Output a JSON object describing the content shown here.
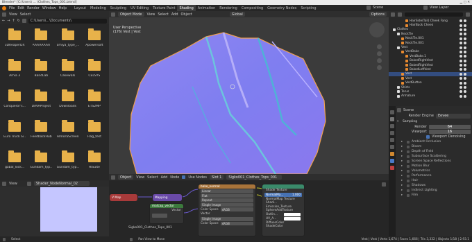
{
  "title_bar": {
    "text": "Blender* [C:\\Users\\ ... \\Clothes_Tops_001.blend]"
  },
  "menu": {
    "items": [
      "File",
      "Edit",
      "Render",
      "Window",
      "Help"
    ]
  },
  "workspaces": [
    "Layout",
    "Modeling",
    "Sculpting",
    "UV Editing",
    "Texture Paint",
    "Shading",
    "Animation",
    "Rendering",
    "Compositing",
    "Geometry Nodes",
    "Scripting"
  ],
  "active_workspace": "Shading",
  "scene": {
    "label": "Scene",
    "view_layer": "View Layer"
  },
  "file_browser": {
    "view_label": "View",
    "select_label": "Select",
    "path": "C:\\Users\\...\\Documents\\",
    "folders": [
      [
        "3DReaperDX",
        "AAAAAAAA",
        "amiya_type_...",
        "Apowersoft"
      ],
      [
        "Arnia 3",
        "BandLab",
        "Cakewalk",
        "CELSYS"
      ],
      [
        "Conqueror's...",
        "DAVAProject",
        "Downloads",
        "ETS2MP"
      ],
      [
        "Euro Truck Si...",
        "FeedbackHub",
        "FilmoraScreen",
        "Flag_test"
      ],
      [
        "gabal_lock...",
        "Gundam_typ...",
        "Gundam_typ...",
        "HiSuite"
      ]
    ]
  },
  "viewport": {
    "mode": "Object Mode",
    "menu": [
      "View",
      "Select",
      "Add",
      "Object"
    ],
    "orientation": "Global",
    "info_line1": "User Perspective",
    "info_line2": "(176) Vest | Vest",
    "options": "Options"
  },
  "outliner": {
    "items": [
      {
        "label": "HairSide(Tail) Cheek Fang",
        "indent": 4
      },
      {
        "label": "HairBack Cheek",
        "indent": 4
      },
      {
        "label": "Clothes",
        "indent": 1
      },
      {
        "label": "NeckTie",
        "indent": 2
      },
      {
        "label": "NeckTie.001",
        "indent": 3
      },
      {
        "label": "NeckTie.001",
        "indent": 3
      },
      {
        "label": "Vest",
        "indent": 2
      },
      {
        "label": "VestBake",
        "indent": 3
      },
      {
        "label": "VestBake.1",
        "indent": 4
      },
      {
        "label": "BakedRightVest",
        "indent": 4
      },
      {
        "label": "BakedRightVest",
        "indent": 4
      },
      {
        "label": "BakedLeftVest",
        "indent": 4
      },
      {
        "label": "Vest",
        "indent": 3
      },
      {
        "label": "Vest",
        "indent": 3
      },
      {
        "label": "VestButton",
        "indent": 3
      },
      {
        "label": "Shirts",
        "indent": 2
      },
      {
        "label": "Torus",
        "indent": 2
      },
      {
        "label": "Armature",
        "indent": 2
      }
    ],
    "selected_index": 12
  },
  "properties": {
    "scene_label": "Scene",
    "render_engine_label": "Render Engine",
    "render_engine_value": "Eevee",
    "sampling": "Sampling",
    "render_label": "Render",
    "render_value": "64",
    "viewport_label": "Viewport",
    "viewport_value": "16",
    "denoise": "Viewport Denoising",
    "sections": [
      "Ambient Occlusion",
      "Bloom",
      "Depth of Field",
      "Subsurface Scattering",
      "Screen Space Reflections",
      "Motion Blur",
      "Volumetrics",
      "Performance",
      "Hair",
      "Shadows",
      "Indirect Lighting",
      "Film"
    ]
  },
  "node_editor": {
    "header": [
      "Object",
      "View",
      "Select",
      "Add",
      "Node",
      "Use Nodes"
    ],
    "slot": "Slot 1",
    "material": "Sigko001_Clothes_Tops_001",
    "nodes": {
      "mapping": "Mapping",
      "vmap": "V Map",
      "matcap_vector": "matcap_vector",
      "vector": "Vector",
      "bake_normal": "bake_normal",
      "img_linear": "Linear",
      "img_flat": "Flat",
      "img_repeat": "Repeat",
      "img_single": "Single Image",
      "color_space_label": "Color Space",
      "color_space_value": "sRGB",
      "vector_label": "Vector",
      "group_title": "Sigko001_Clothes_Tops_001",
      "group_inputs": [
        "Shade Texture",
        "NormalMap Texture",
        "Shadi...",
        "Emission_Texture",
        "SphereAddTexture",
        "Outlin...",
        "UV_A...",
        "DiffuseColor",
        "ShadeColor"
      ],
      "slider_label": "NormalMa...",
      "slider_value": "1.000"
    }
  },
  "image_editor": {
    "view": "View",
    "image_name": "Shader_NodeNormal_02"
  },
  "status_bar": {
    "left": "Select",
    "mid": "Pan View to Move",
    "right": "Vest | Vest | Verts 1,674 | Faces 1,666 | Tris 3,332 | Objects 1/18 | 2.93.1"
  },
  "colors": {
    "accent": "#4772b3",
    "selected_row": "#334d80",
    "folder": "#e8b24a",
    "mesh": "#8a86f0"
  }
}
